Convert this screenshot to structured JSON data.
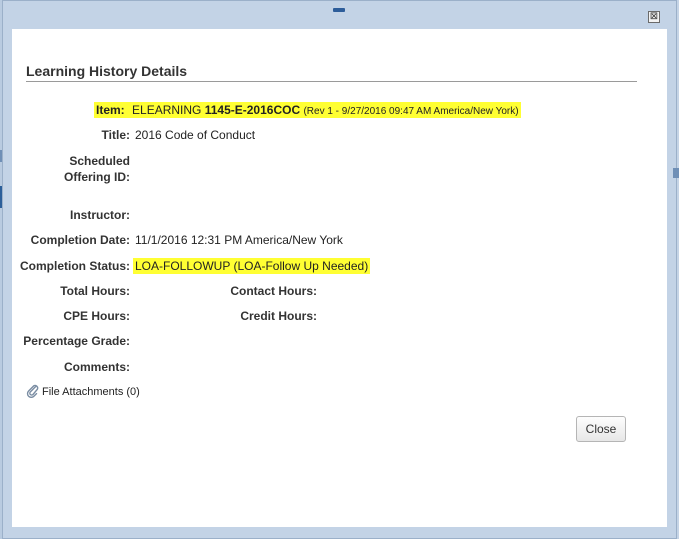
{
  "dialog": {
    "close_glyph": "⊠",
    "heading": "Learning History Details"
  },
  "item": {
    "label": "Item:",
    "prefix": "ELEARNING",
    "code": "1145-E-2016COC",
    "revision": "(Rev 1 - 9/27/2016 09:47 AM America/New York)"
  },
  "title": {
    "label": "Title:",
    "value": "2016 Code of Conduct"
  },
  "scheduled_offering": {
    "label_line1": "Scheduled",
    "label_line2": "Offering ID:",
    "value": ""
  },
  "instructor": {
    "label": "Instructor:",
    "value": ""
  },
  "completion_date": {
    "label": "Completion Date:",
    "value": "11/1/2016 12:31 PM America/New York"
  },
  "completion_status": {
    "label": "Completion Status:",
    "value": "LOA-FOLLOWUP (LOA-Follow Up Needed)"
  },
  "total_hours": {
    "label": "Total Hours:",
    "value": ""
  },
  "contact_hours": {
    "label": "Contact Hours:",
    "value": ""
  },
  "cpe_hours": {
    "label": "CPE Hours:",
    "value": ""
  },
  "credit_hours": {
    "label": "Credit Hours:",
    "value": ""
  },
  "percentage_grade": {
    "label": "Percentage Grade:",
    "value": ""
  },
  "comments": {
    "label": "Comments:",
    "value": ""
  },
  "attachments": {
    "label": "File Attachments (0)",
    "icon": "paperclip-icon"
  },
  "buttons": {
    "close_label": "Close"
  },
  "colors": {
    "highlight": "#ffff33",
    "frame": "#c3d3e6"
  }
}
